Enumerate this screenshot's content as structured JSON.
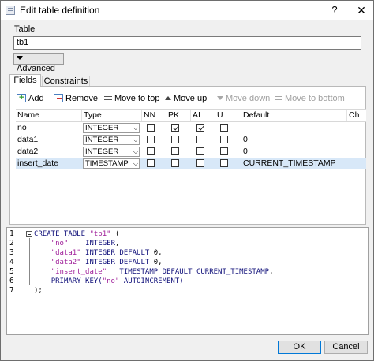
{
  "window": {
    "title": "Edit table definition",
    "help_label": "?",
    "close_label": "✕"
  },
  "table": {
    "section_label": "Table",
    "name_value": "tb1",
    "advanced_label": "Advanced"
  },
  "tabs": [
    {
      "label": "Fields",
      "active": true
    },
    {
      "label": "Constraints",
      "active": false
    }
  ],
  "toolbar": {
    "add_label": "Add",
    "remove_label": "Remove",
    "move_top_label": "Move to top",
    "move_up_label": "Move up",
    "move_down_label": "Move down",
    "move_bottom_label": "Move to bottom"
  },
  "grid": {
    "columns": [
      "Name",
      "Type",
      "NN",
      "PK",
      "AI",
      "U",
      "Default",
      "Ch"
    ],
    "rows": [
      {
        "name": "no",
        "type": "INTEGER",
        "nn": false,
        "pk": true,
        "ai": true,
        "u": false,
        "default": ""
      },
      {
        "name": "data1",
        "type": "INTEGER",
        "nn": false,
        "pk": false,
        "ai": false,
        "u": false,
        "default": "0"
      },
      {
        "name": "data2",
        "type": "INTEGER",
        "nn": false,
        "pk": false,
        "ai": false,
        "u": false,
        "default": "0"
      },
      {
        "name": "insert_date",
        "type": "TIMESTAMP",
        "nn": false,
        "pk": false,
        "ai": false,
        "u": false,
        "default": "CURRENT_TIMESTAMP",
        "selected": true
      }
    ]
  },
  "sql": {
    "line_numbers": [
      "1",
      "2",
      "3",
      "4",
      "5",
      "6",
      "7"
    ],
    "lines": [
      [
        {
          "t": "CREATE TABLE ",
          "c": "kw"
        },
        {
          "t": "\"tb1\"",
          "c": "str"
        },
        {
          "t": " (",
          "c": "punct"
        }
      ],
      [
        {
          "t": "    ",
          "c": "punct"
        },
        {
          "t": "\"no\"",
          "c": "str"
        },
        {
          "t": "    ",
          "c": "punct"
        },
        {
          "t": "INTEGER",
          "c": "kw"
        },
        {
          "t": ",",
          "c": "punct"
        }
      ],
      [
        {
          "t": "    ",
          "c": "punct"
        },
        {
          "t": "\"data1\"",
          "c": "str"
        },
        {
          "t": " ",
          "c": "punct"
        },
        {
          "t": "INTEGER DEFAULT ",
          "c": "kw"
        },
        {
          "t": "0",
          "c": "num"
        },
        {
          "t": ",",
          "c": "punct"
        }
      ],
      [
        {
          "t": "    ",
          "c": "punct"
        },
        {
          "t": "\"data2\"",
          "c": "str"
        },
        {
          "t": " ",
          "c": "punct"
        },
        {
          "t": "INTEGER DEFAULT ",
          "c": "kw"
        },
        {
          "t": "0",
          "c": "num"
        },
        {
          "t": ",",
          "c": "punct"
        }
      ],
      [
        {
          "t": "    ",
          "c": "punct"
        },
        {
          "t": "\"insert_date\"",
          "c": "str"
        },
        {
          "t": "   ",
          "c": "punct"
        },
        {
          "t": "TIMESTAMP DEFAULT CURRENT_TIMESTAMP",
          "c": "kw"
        },
        {
          "t": ",",
          "c": "punct"
        }
      ],
      [
        {
          "t": "    ",
          "c": "punct"
        },
        {
          "t": "PRIMARY KEY(",
          "c": "kw"
        },
        {
          "t": "\"no\"",
          "c": "str"
        },
        {
          "t": " AUTOINCREMENT)",
          "c": "kw"
        }
      ],
      [
        {
          "t": ");",
          "c": "punct"
        }
      ]
    ]
  },
  "buttons": {
    "ok_label": "OK",
    "cancel_label": "Cancel"
  },
  "colors": {
    "selected_row": "#d8e8f8",
    "keyword": "#10107a",
    "string": "#a0209a",
    "ok_border": "#0078d7"
  }
}
